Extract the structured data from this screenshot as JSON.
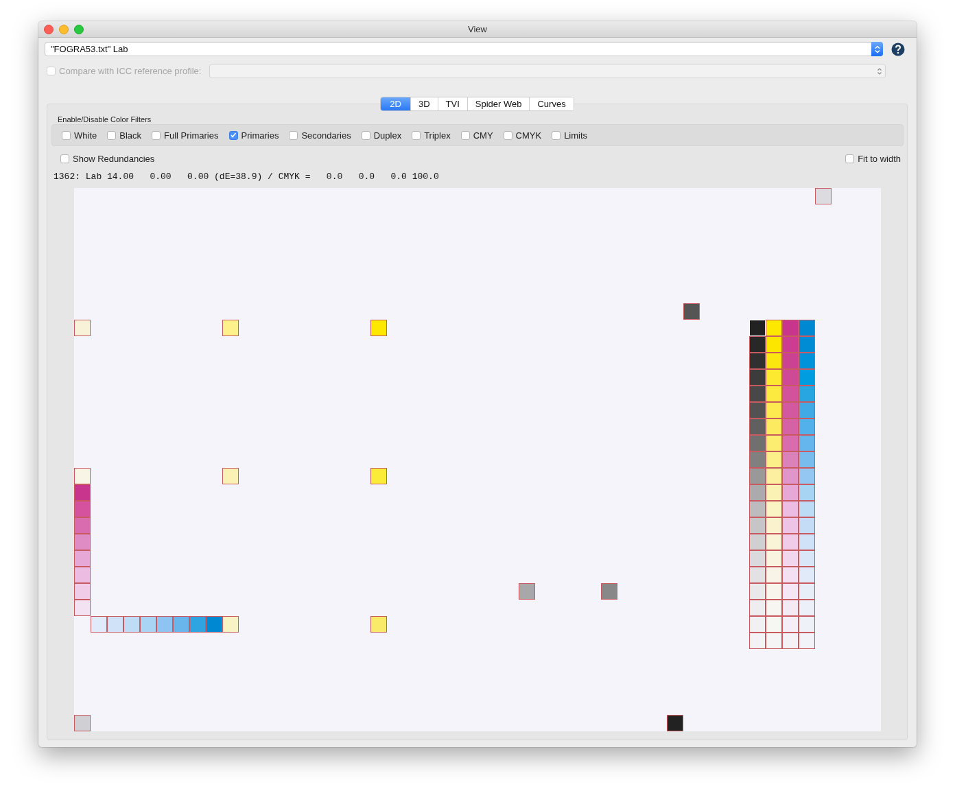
{
  "window": {
    "title": "View"
  },
  "data_source": {
    "value": "\"FOGRA53.txt\" Lab"
  },
  "compare": {
    "label": "Compare with ICC reference profile:",
    "checked": false,
    "disabled": true
  },
  "tabs": [
    {
      "label": "2D",
      "selected": true
    },
    {
      "label": "3D",
      "selected": false
    },
    {
      "label": "TVI",
      "selected": false
    },
    {
      "label": "Spider Web",
      "selected": false
    },
    {
      "label": "Curves",
      "selected": false
    }
  ],
  "filters": {
    "title": "Enable/Disable Color Filters",
    "items": [
      {
        "label": "White",
        "checked": false
      },
      {
        "label": "Black",
        "checked": false
      },
      {
        "label": "Full Primaries",
        "checked": false
      },
      {
        "label": "Primaries",
        "checked": true
      },
      {
        "label": "Secondaries",
        "checked": false
      },
      {
        "label": "Duplex",
        "checked": false
      },
      {
        "label": "Triplex",
        "checked": false
      },
      {
        "label": "CMY",
        "checked": false
      },
      {
        "label": "CMYK",
        "checked": false
      },
      {
        "label": "Limits",
        "checked": false
      }
    ]
  },
  "show_redundancies": {
    "label": "Show Redundancies",
    "checked": false
  },
  "fit_to_width": {
    "label": "Fit to width",
    "checked": false
  },
  "info_line": "1362: Lab 14.00   0.00   0.00 (dE=38.9) / CMYK =   0.0   0.0   0.0 100.0",
  "patches": [
    {
      "color": "#dcdce0",
      "selected": false
    },
    {
      "color": "#555555",
      "selected": false
    },
    {
      "color": "#f8f3d8",
      "selected": false
    },
    {
      "color": "#fdf18c",
      "selected": false
    },
    {
      "color": "#fce800",
      "selected": false
    },
    {
      "color": "#f8f5e6",
      "selected": false
    },
    {
      "color": "#faf2b4",
      "selected": false
    },
    {
      "color": "#fcec3a",
      "selected": false
    },
    {
      "color": "#c8358c",
      "selected": false
    },
    {
      "color": "#d4529e",
      "selected": false
    },
    {
      "color": "#d86cae",
      "selected": false
    },
    {
      "color": "#e08cc4",
      "selected": false
    },
    {
      "color": "#e6a8d6",
      "selected": false
    },
    {
      "color": "#ecbce2",
      "selected": false
    },
    {
      "color": "#f0cce8",
      "selected": false
    },
    {
      "color": "#f3e2f2",
      "selected": false
    },
    {
      "color": "#e0eafa",
      "selected": false
    },
    {
      "color": "#d0e2f8",
      "selected": false
    },
    {
      "color": "#bedcf6",
      "selected": false
    },
    {
      "color": "#aad4f4",
      "selected": false
    },
    {
      "color": "#8ec4f2",
      "selected": false
    },
    {
      "color": "#68b6ec",
      "selected": false
    },
    {
      "color": "#2ea4e2",
      "selected": false
    },
    {
      "color": "#0088d2",
      "selected": false
    },
    {
      "color": "#f8f3c4",
      "selected": false
    },
    {
      "color": "#faea6a",
      "selected": false
    },
    {
      "color": "#a8a8aa",
      "selected": false
    },
    {
      "color": "#888888",
      "selected": false
    },
    {
      "color": "#d0d0d4",
      "selected": false
    },
    {
      "color": "#222222",
      "selected": false
    },
    {
      "color": "#222222",
      "selected": true
    },
    {
      "color": "#282828",
      "selected": false
    },
    {
      "color": "#303030",
      "selected": false
    },
    {
      "color": "#3c3c3c",
      "selected": false
    },
    {
      "color": "#484848",
      "selected": false
    },
    {
      "color": "#525252",
      "selected": false
    },
    {
      "color": "#606060",
      "selected": false
    },
    {
      "color": "#707070",
      "selected": false
    },
    {
      "color": "#808080",
      "selected": false
    },
    {
      "color": "#999999",
      "selected": false
    },
    {
      "color": "#ababad",
      "selected": false
    },
    {
      "color": "#bcbcbf",
      "selected": false
    },
    {
      "color": "#c6c6c9",
      "selected": false
    },
    {
      "color": "#d0d0d3",
      "selected": false
    },
    {
      "color": "#dadade",
      "selected": false
    },
    {
      "color": "#e2e2e5",
      "selected": false
    },
    {
      "color": "#e9e9ec",
      "selected": false
    },
    {
      "color": "#eeeef1",
      "selected": false
    },
    {
      "color": "#f1f1f4",
      "selected": false
    },
    {
      "color": "#f3f3f6",
      "selected": false
    },
    {
      "color": "#fce800",
      "selected": false
    },
    {
      "color": "#fce600",
      "selected": false
    },
    {
      "color": "#fce610",
      "selected": false
    },
    {
      "color": "#fce930",
      "selected": false
    },
    {
      "color": "#fcea40",
      "selected": false
    },
    {
      "color": "#fcea50",
      "selected": false
    },
    {
      "color": "#fceb60",
      "selected": false
    },
    {
      "color": "#fcec70",
      "selected": false
    },
    {
      "color": "#fcee88",
      "selected": false
    },
    {
      "color": "#fcf0a0",
      "selected": false
    },
    {
      "color": "#faf2b4",
      "selected": false
    },
    {
      "color": "#faf4c4",
      "selected": false
    },
    {
      "color": "#f9f2cc",
      "selected": false
    },
    {
      "color": "#f9f3d8",
      "selected": false
    },
    {
      "color": "#f9f4e0",
      "selected": false
    },
    {
      "color": "#f8f5e8",
      "selected": false
    },
    {
      "color": "#f8f6ec",
      "selected": false
    },
    {
      "color": "#f7f6f0",
      "selected": false
    },
    {
      "color": "#f6f6f3",
      "selected": false
    },
    {
      "color": "#f5f5f5",
      "selected": false
    },
    {
      "color": "#c8358c",
      "selected": false
    },
    {
      "color": "#cc3c90",
      "selected": false
    },
    {
      "color": "#cc4292",
      "selected": false
    },
    {
      "color": "#cf4a96",
      "selected": false
    },
    {
      "color": "#d2529c",
      "selected": false
    },
    {
      "color": "#d258a0",
      "selected": false
    },
    {
      "color": "#d662a6",
      "selected": false
    },
    {
      "color": "#d86cae",
      "selected": false
    },
    {
      "color": "#dc82ba",
      "selected": false
    },
    {
      "color": "#e096ca",
      "selected": false
    },
    {
      "color": "#e6a8d6",
      "selected": false
    },
    {
      "color": "#ecbce2",
      "selected": false
    },
    {
      "color": "#eec4e6",
      "selected": false
    },
    {
      "color": "#f0cce8",
      "selected": false
    },
    {
      "color": "#f1d6ee",
      "selected": false
    },
    {
      "color": "#f3e0f2",
      "selected": false
    },
    {
      "color": "#f4e6f4",
      "selected": false
    },
    {
      "color": "#f4eaf4",
      "selected": false
    },
    {
      "color": "#f4eef6",
      "selected": false
    },
    {
      "color": "#f4f1f7",
      "selected": false
    },
    {
      "color": "#0088d2",
      "selected": false
    },
    {
      "color": "#008cd4",
      "selected": false
    },
    {
      "color": "#0092da",
      "selected": false
    },
    {
      "color": "#009ee0",
      "selected": false
    },
    {
      "color": "#28a6e2",
      "selected": false
    },
    {
      "color": "#40aae6",
      "selected": false
    },
    {
      "color": "#52b0ea",
      "selected": false
    },
    {
      "color": "#64b6ec",
      "selected": false
    },
    {
      "color": "#78bcee",
      "selected": false
    },
    {
      "color": "#94c8f2",
      "selected": false
    },
    {
      "color": "#a8d4f4",
      "selected": false
    },
    {
      "color": "#bcdcf6",
      "selected": false
    },
    {
      "color": "#c4dcf6",
      "selected": false
    },
    {
      "color": "#d0e2f8",
      "selected": false
    },
    {
      "color": "#d8e6f8",
      "selected": false
    },
    {
      "color": "#e0eaf8",
      "selected": false
    },
    {
      "color": "#e8eef8",
      "selected": false
    },
    {
      "color": "#ecf0f8",
      "selected": false
    },
    {
      "color": "#eef2f8",
      "selected": false
    },
    {
      "color": "#f1f3f8",
      "selected": false
    }
  ]
}
